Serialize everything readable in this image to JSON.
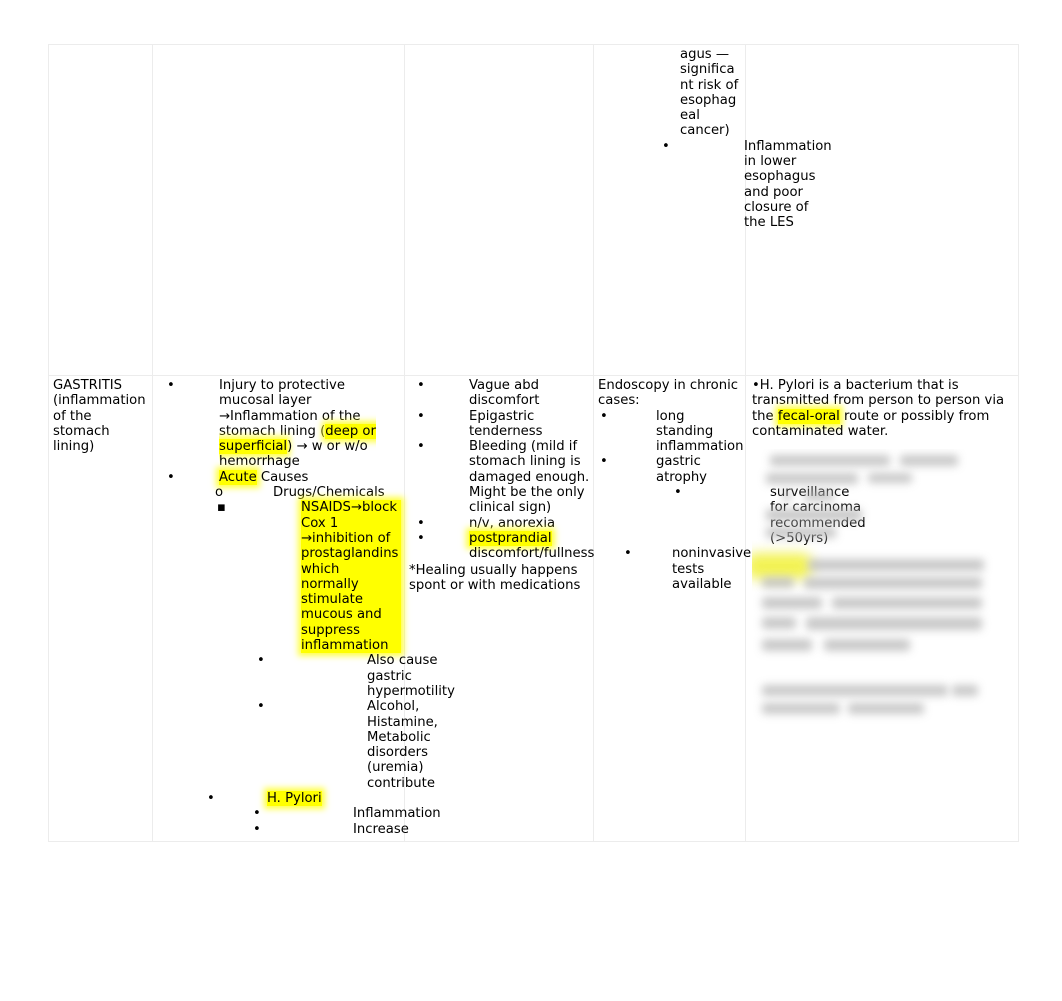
{
  "document": {
    "type": "comparison-table",
    "columns": 5
  },
  "table": {
    "row_top": {
      "col1": "",
      "col2": "",
      "col3": "",
      "col4": {
        "continuation_text": "agus — significant risk of esophageal cancer)",
        "bullets": [
          "Inflammation in lower esophagus and poor closure of the LES"
        ]
      },
      "col5": ""
    },
    "row_gastritis": {
      "col1": {
        "title": "GASTRITIS (inflammation of the stomach lining)"
      },
      "col2": {
        "b1_pre": "Injury to protective mucosal layer →Inflammation of the stomach lining (",
        "b1_hl": "deep or superficial",
        "b1_post": ") → w or w/o hemorrhage",
        "b2_hl": "Acute",
        "b2_post": " Causes",
        "b2_sub1": "Drugs/Chemicals",
        "b2_sub1_a_hl": "NSAIDS→block Cox 1 →inhibition of prostaglandins which normally stimulate mucous and suppress inflammation",
        "b2_sub1_a_i": "Also cause gastric hypermotility",
        "b2_sub1_a_ii": "Alcohol, Histamine, Metabolic disorders (uremia) contribute",
        "b3_hl": "H. Pylori",
        "b3_sub1": "Inflammation",
        "b3_sub2": "Increase"
      },
      "col3": {
        "b1": "Vague abd discomfort",
        "b2": "Epigastric tenderness",
        "b3": "Bleeding (mild if stomach lining is damaged enough. Might be the only clinical sign)",
        "b4": "n/v, anorexia",
        "b5_hl": "postprandial",
        "b5_post": " discomfort/fullness",
        "note": "*Healing usually happens spont or with medications"
      },
      "col4": {
        "heading": "Endoscopy in chronic cases:",
        "b1": "long standing inflammation",
        "b2": "gastric atrophy",
        "b2_sub": "surveillance for carcinoma recommended (>50yrs)",
        "b3": "noninvasive tests available"
      },
      "col5": {
        "bullet_char": "•",
        "text_pre": "H. Pylori is a bacterium that is transmitted from person to person via the ",
        "text_hl": "fecal-oral",
        "text_post": " route or possibly from contaminated water.",
        "redacted_note": ""
      }
    }
  },
  "colors": {
    "highlight": "#ffff00",
    "text": "#000000",
    "border": "#ececec",
    "redacted_gray": "#b9b9b9"
  }
}
